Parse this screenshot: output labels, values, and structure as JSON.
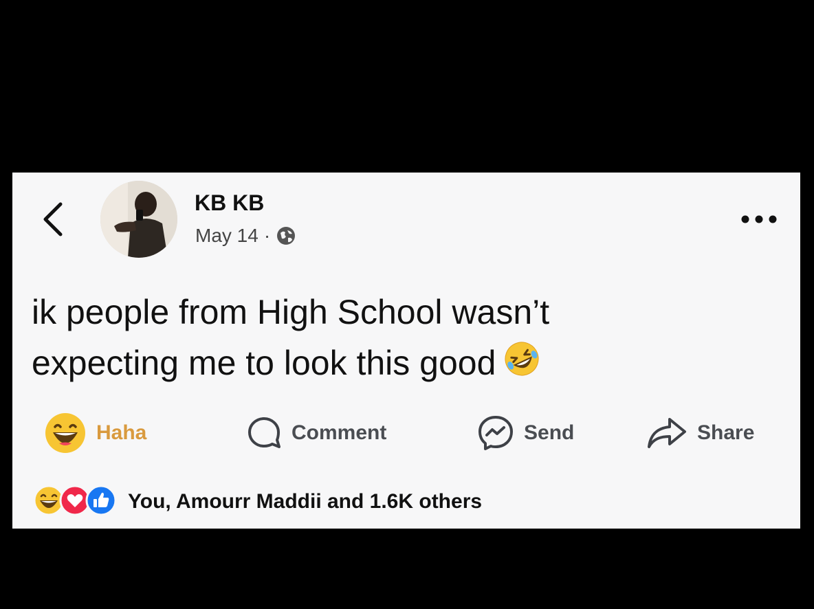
{
  "post": {
    "author": "KB KB",
    "date": "May 14",
    "separator": "·",
    "privacy_icon": "globe-icon",
    "text_line1": "ik people from High School wasn’t",
    "text_line2": "expecting me to look this good",
    "text_emoji": "rofl-emoji"
  },
  "actions": {
    "haha_label": "Haha",
    "comment_label": "Comment",
    "send_label": "Send",
    "share_label": "Share"
  },
  "reactions": {
    "summary": "You, Amourr Maddii and 1.6K others",
    "icons": [
      "haha-reaction-icon",
      "love-reaction-icon",
      "like-reaction-icon"
    ]
  },
  "colors": {
    "haha_accent": "#d99a3e",
    "love": "#f0284a",
    "like": "#1877f2",
    "card_bg": "#f7f7f8"
  }
}
